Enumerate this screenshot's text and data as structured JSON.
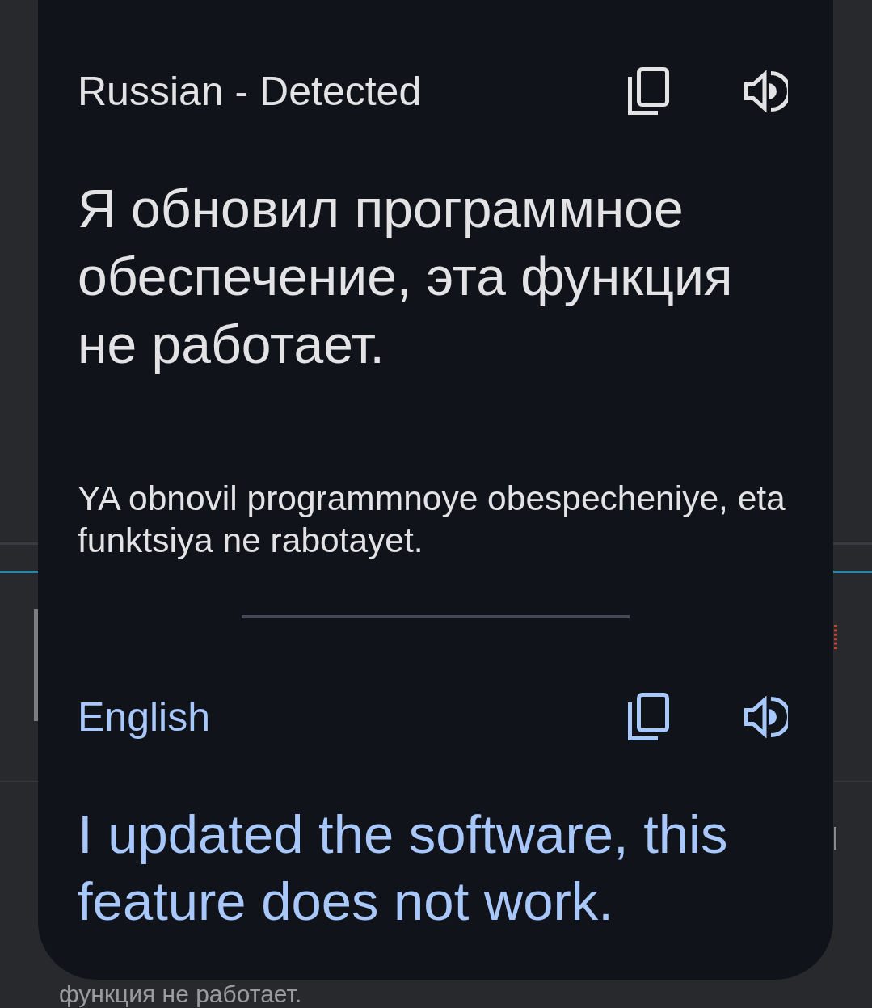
{
  "source": {
    "language": "Russian - Detected",
    "text": "Я обновил программное обеспечение, эта функция не работает.",
    "transliteration": "YA obnovil programmnoye obespecheniye, eta funktsiya ne rabotayet."
  },
  "target": {
    "language": "English",
    "text": "I updated the software, this feature does not work."
  },
  "background": {
    "text": "функция не работает."
  }
}
